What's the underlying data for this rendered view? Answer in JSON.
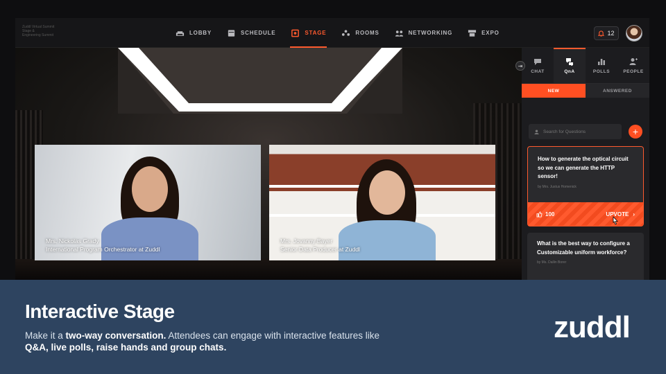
{
  "brand": {
    "line1": "Zuddl Virtual Summit",
    "line2": "Stage &",
    "line3": "Engineering Summit"
  },
  "nav": [
    {
      "label": "LOBBY",
      "icon": "sofa-icon"
    },
    {
      "label": "SCHEDULE",
      "icon": "calendar-icon"
    },
    {
      "label": "STAGE",
      "icon": "stage-icon",
      "active": true
    },
    {
      "label": "ROOMS",
      "icon": "rooms-icon"
    },
    {
      "label": "NETWORKING",
      "icon": "networking-icon"
    },
    {
      "label": "EXPO",
      "icon": "expo-icon"
    }
  ],
  "notifications": {
    "count": "12",
    "icon": "bell-icon"
  },
  "speakers": [
    {
      "name": "Mrs. Nickolas Grady",
      "title": "International Program Orchestrator at Zuddl"
    },
    {
      "name": "Mrs. Jovanny Bayer",
      "title": "Senior Data Producer at Zuddl"
    }
  ],
  "panel": {
    "tabs": [
      {
        "label": "CHAT",
        "icon": "chat-icon"
      },
      {
        "label": "QnA",
        "icon": "qna-icon",
        "active": true
      },
      {
        "label": "POLLS",
        "icon": "polls-icon"
      },
      {
        "label": "PEOPLE",
        "icon": "people-icon"
      }
    ],
    "subtabs": [
      {
        "label": "NEW",
        "active": true
      },
      {
        "label": "ANSWERED"
      }
    ],
    "search_placeholder": "Search for Questions",
    "questions": [
      {
        "text": "How to generate the optical circuit so we can generate the HTTP sensor!",
        "by": "by Mrs. Justus Homenick",
        "upvotes": "100",
        "upvote_label": "UPVOTE"
      },
      {
        "text": "What is the best way to configure a Customizable uniform workforce?",
        "by": "by Ms. Dallin Borer"
      }
    ]
  },
  "banner": {
    "title": "Interactive Stage",
    "desc_1": "Make it a ",
    "desc_2": "two-way conversation.",
    "desc_3": " Attendees can engage with interactive features like ",
    "desc_4": "Q&A, live polls, raise hands and group chats.",
    "logo": "zuddl"
  },
  "colors": {
    "accent": "#ff5a2e",
    "banner_bg": "#2e4460",
    "panel_bg": "#1c1c1f"
  }
}
